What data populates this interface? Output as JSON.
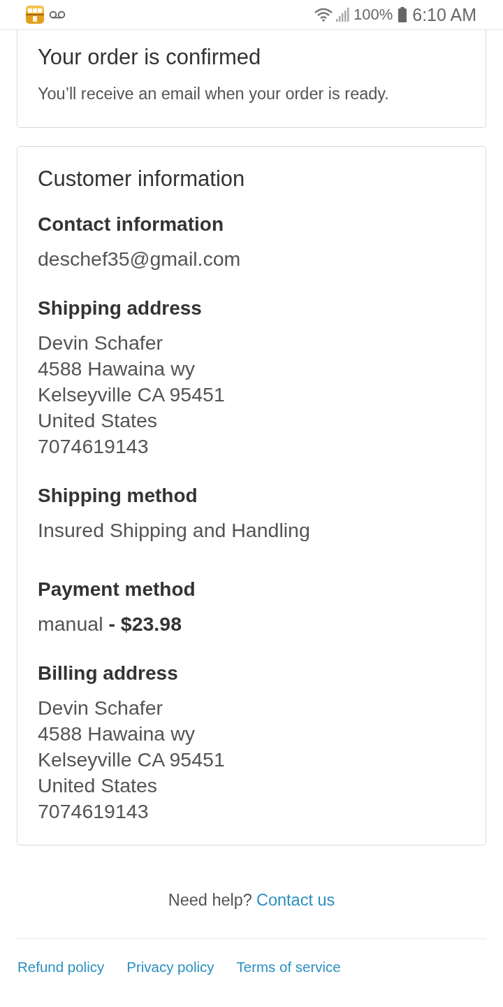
{
  "status_bar": {
    "battery": "100%",
    "time": "6:10 AM"
  },
  "order_status": {
    "title": "Your order is confirmed",
    "message": "You’ll receive an email when your order is ready."
  },
  "customer_information": {
    "title": "Customer information",
    "sections": [
      {
        "heading": "Contact information",
        "lines": [
          "deschef35@gmail.com"
        ]
      },
      {
        "heading": "Shipping address",
        "lines": [
          "Devin Schafer",
          "4588 Hawaina wy",
          "Kelseyville CA 95451",
          "United States",
          "7074619143"
        ]
      },
      {
        "heading": "Shipping method",
        "lines": [
          "Insured Shipping and Handling"
        ]
      },
      {
        "heading": "Payment method",
        "lines": [
          "manual **- $23.98**"
        ]
      },
      {
        "heading": "Billing address",
        "lines": [
          "Devin Schafer",
          "4588 Hawaina wy",
          "Kelseyville CA 95451",
          "United States",
          "7074619143"
        ]
      }
    ]
  },
  "help": {
    "text": "Need help?",
    "link": "Contact us"
  },
  "footer_links": [
    "Refund policy",
    "Privacy policy",
    "Terms of service"
  ]
}
